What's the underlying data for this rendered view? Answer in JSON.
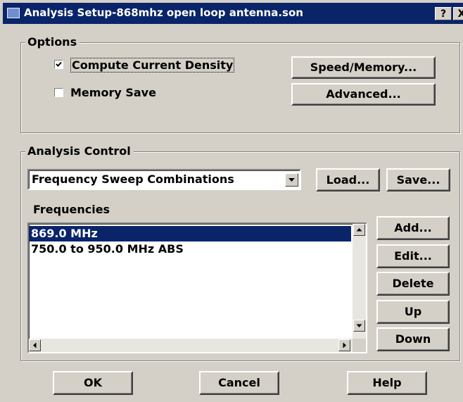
{
  "window": {
    "title": "Analysis Setup-868mhz open loop antenna.son",
    "help_button": "?",
    "close_button": "X"
  },
  "options": {
    "legend": "Options",
    "compute_current_density": {
      "label": "Compute Current Density",
      "checked": true
    },
    "memory_save": {
      "label": "Memory Save",
      "checked": false
    },
    "speed_memory_button": "Speed/Memory...",
    "advanced_button": "Advanced..."
  },
  "analysis_control": {
    "legend": "Analysis Control",
    "sweep_type": "Frequency Sweep Combinations",
    "load_button": "Load...",
    "save_button": "Save...",
    "frequencies_label": "Frequencies",
    "frequencies": [
      {
        "text": "869.0 MHz",
        "selected": true
      },
      {
        "text": "750.0 to 950.0 MHz ABS",
        "selected": false
      }
    ],
    "add_button": "Add...",
    "edit_button": "Edit...",
    "delete_button": "Delete",
    "up_button": "Up",
    "down_button": "Down"
  },
  "footer": {
    "ok_button": "OK",
    "cancel_button": "Cancel",
    "help_button": "Help"
  },
  "colors": {
    "titlebar": "#0a246a",
    "dialog_face": "#d4d0c8",
    "selection": "#0a246a"
  }
}
